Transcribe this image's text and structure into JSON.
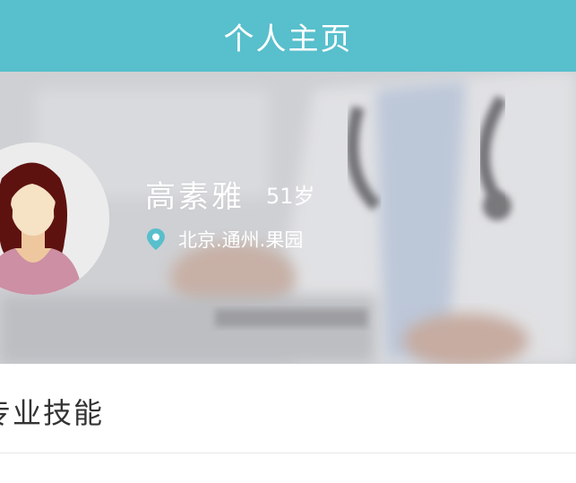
{
  "header": {
    "title": "个人主页"
  },
  "profile": {
    "name": "高素雅",
    "age": "51岁",
    "location": "北京.通州.果园",
    "avatar_icon": "woman-avatar-icon"
  },
  "sections": {
    "skills_title": "专业技能"
  },
  "colors": {
    "brand": "#58bfcc",
    "pin": "#58bfcc"
  }
}
